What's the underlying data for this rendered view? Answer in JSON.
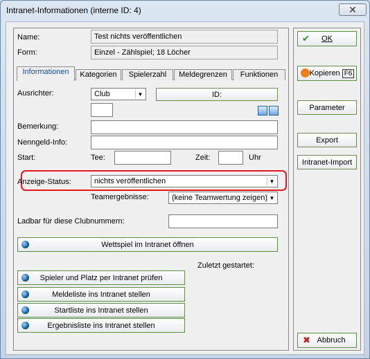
{
  "window": {
    "title": "Intranet-Informationen (interne ID: 4)",
    "close_glyph": "✕"
  },
  "header": {
    "name_label": "Name:",
    "name_value": "Test nichts veröffentlichen",
    "form_label": "Form:",
    "form_value": "Einzel - Zählspiel; 18 Löcher"
  },
  "tabs": [
    "Informationen",
    "Kategorien",
    "Spielerzahl",
    "Meldegrenzen",
    "Funktionen"
  ],
  "info": {
    "ausrichter_label": "Ausrichter:",
    "ausrichter_value": "Club",
    "id_button": "ID:",
    "bemerkung_label": "Bemerkung:",
    "nenngeld_label": "Nenngeld-Info:",
    "start_label": "Start:",
    "tee_label": "Tee:",
    "zeit_label": "Zeit:",
    "uhr_label": "Uhr",
    "anzeige_label": "Anzeige-Status:",
    "anzeige_value": "nichts veröffentlichen",
    "team_label": "Teamergebnisse:",
    "team_value": "(keine Teamwertung zeigen)",
    "ladbar_label": "Ladbar für diese Clubnummern:",
    "open_button": "Wettspiel im Intranet öffnen",
    "zuletzt_label": "Zuletzt gestartet:",
    "actions": [
      "Spieler und Platz per Intranet prüfen",
      "Meldeliste ins Intranet stellen",
      "Startliste ins Intranet stellen",
      "Ergebnisliste ins Intranet stellen"
    ]
  },
  "sidebar": {
    "ok": "OK",
    "kopieren": "Kopieren",
    "f6": "F6",
    "parameter": "Parameter",
    "export": "Export",
    "intranet_import": "Intranet-Import",
    "abbruch": "Abbruch"
  },
  "colors": {
    "highlight": "#e5161d",
    "ok_check": "#2e8b2e",
    "cancel_x": "#c81e1e"
  }
}
